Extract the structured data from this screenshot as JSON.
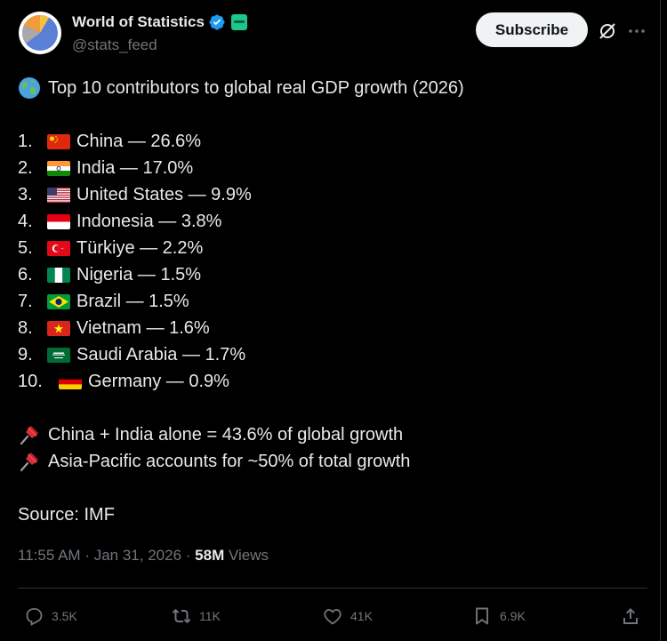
{
  "header": {
    "display_name": "World of Statistics",
    "handle": "@stats_feed",
    "subscribe_label": "Subscribe"
  },
  "tweet": {
    "title": "Top 10 contributors to global real GDP growth (2026)",
    "title_icon": "globe-emoji",
    "ranking": [
      {
        "rank": "1.",
        "flag": "china-flag",
        "text": "China — 26.6%"
      },
      {
        "rank": "2.",
        "flag": "india-flag",
        "text": "India — 17.0%"
      },
      {
        "rank": "3.",
        "flag": "us-flag",
        "text": "United States — 9.9%"
      },
      {
        "rank": "4.",
        "flag": "indonesia-flag",
        "text": "Indonesia — 3.8%"
      },
      {
        "rank": "5.",
        "flag": "turkiye-flag",
        "text": "Türkiye — 2.2%"
      },
      {
        "rank": "6.",
        "flag": "nigeria-flag",
        "text": "Nigeria — 1.5%"
      },
      {
        "rank": "7.",
        "flag": "brazil-flag",
        "text": "Brazil — 1.5%"
      },
      {
        "rank": "8.",
        "flag": "vietnam-flag",
        "text": "Vietnam — 1.6%"
      },
      {
        "rank": "9.",
        "flag": "saudi-flag",
        "text": "Saudi Arabia — 1.7%"
      },
      {
        "rank": "10.",
        "flag": "germany-flag",
        "text": "Germany — 0.9%"
      }
    ],
    "notes": [
      {
        "icon": "pushpin-emoji",
        "text": "China + India alone = 43.6% of global growth"
      },
      {
        "icon": "pushpin-emoji",
        "text": "Asia-Pacific accounts for ~50% of total growth"
      }
    ],
    "source": "Source: IMF"
  },
  "meta": {
    "time": "11:55 AM",
    "separator": "·",
    "date": "Jan 31, 2026",
    "views_count": "58M",
    "views_label": "Views"
  },
  "actions": {
    "replies": "3.5K",
    "reposts": "11K",
    "likes": "41K",
    "bookmarks": "6.9K"
  },
  "colors": {
    "background": "#000000",
    "text": "#e7e9ea",
    "muted": "#71767b",
    "verified": "#1d9bf0",
    "subscribe_bg": "#eff3f4"
  }
}
